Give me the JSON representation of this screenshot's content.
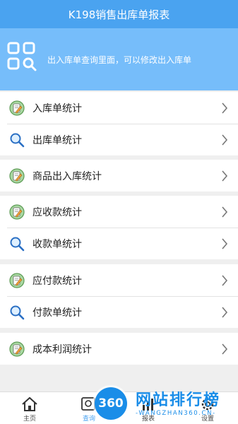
{
  "app": {
    "title": "K198销售出库单报表"
  },
  "banner": {
    "icon": "grid-search-icon",
    "text": "出入库单查询里面，可以修改出入库单"
  },
  "groups": [
    {
      "items": [
        {
          "label": "入库单统计",
          "icon": "edit-note-icon"
        },
        {
          "label": "出库单统计",
          "icon": "search-icon"
        }
      ]
    },
    {
      "items": [
        {
          "label": "商品出入库统计",
          "icon": "edit-note-icon"
        }
      ]
    },
    {
      "items": [
        {
          "label": "应收款统计",
          "icon": "edit-note-icon"
        },
        {
          "label": "收款单统计",
          "icon": "search-icon"
        }
      ]
    },
    {
      "items": [
        {
          "label": "应付款统计",
          "icon": "edit-note-icon"
        },
        {
          "label": "付款单统计",
          "icon": "search-icon"
        }
      ]
    },
    {
      "items": [
        {
          "label": "成本利润统计",
          "icon": "edit-note-icon"
        }
      ]
    }
  ],
  "tabs": [
    {
      "label": "主页",
      "icon": "home-icon"
    },
    {
      "label": "查询",
      "icon": "query-icon"
    },
    {
      "label": "报表",
      "icon": "report-icon"
    },
    {
      "label": "设置",
      "icon": "settings-icon"
    }
  ],
  "watermark": {
    "badge": "360",
    "title": "网站排行榜",
    "subtitle": "-WANGZHAN360.CN-"
  },
  "colors": {
    "titlebar": "#4aa3f0",
    "banner": "#76bdfa",
    "accent": "#1a8de8"
  }
}
